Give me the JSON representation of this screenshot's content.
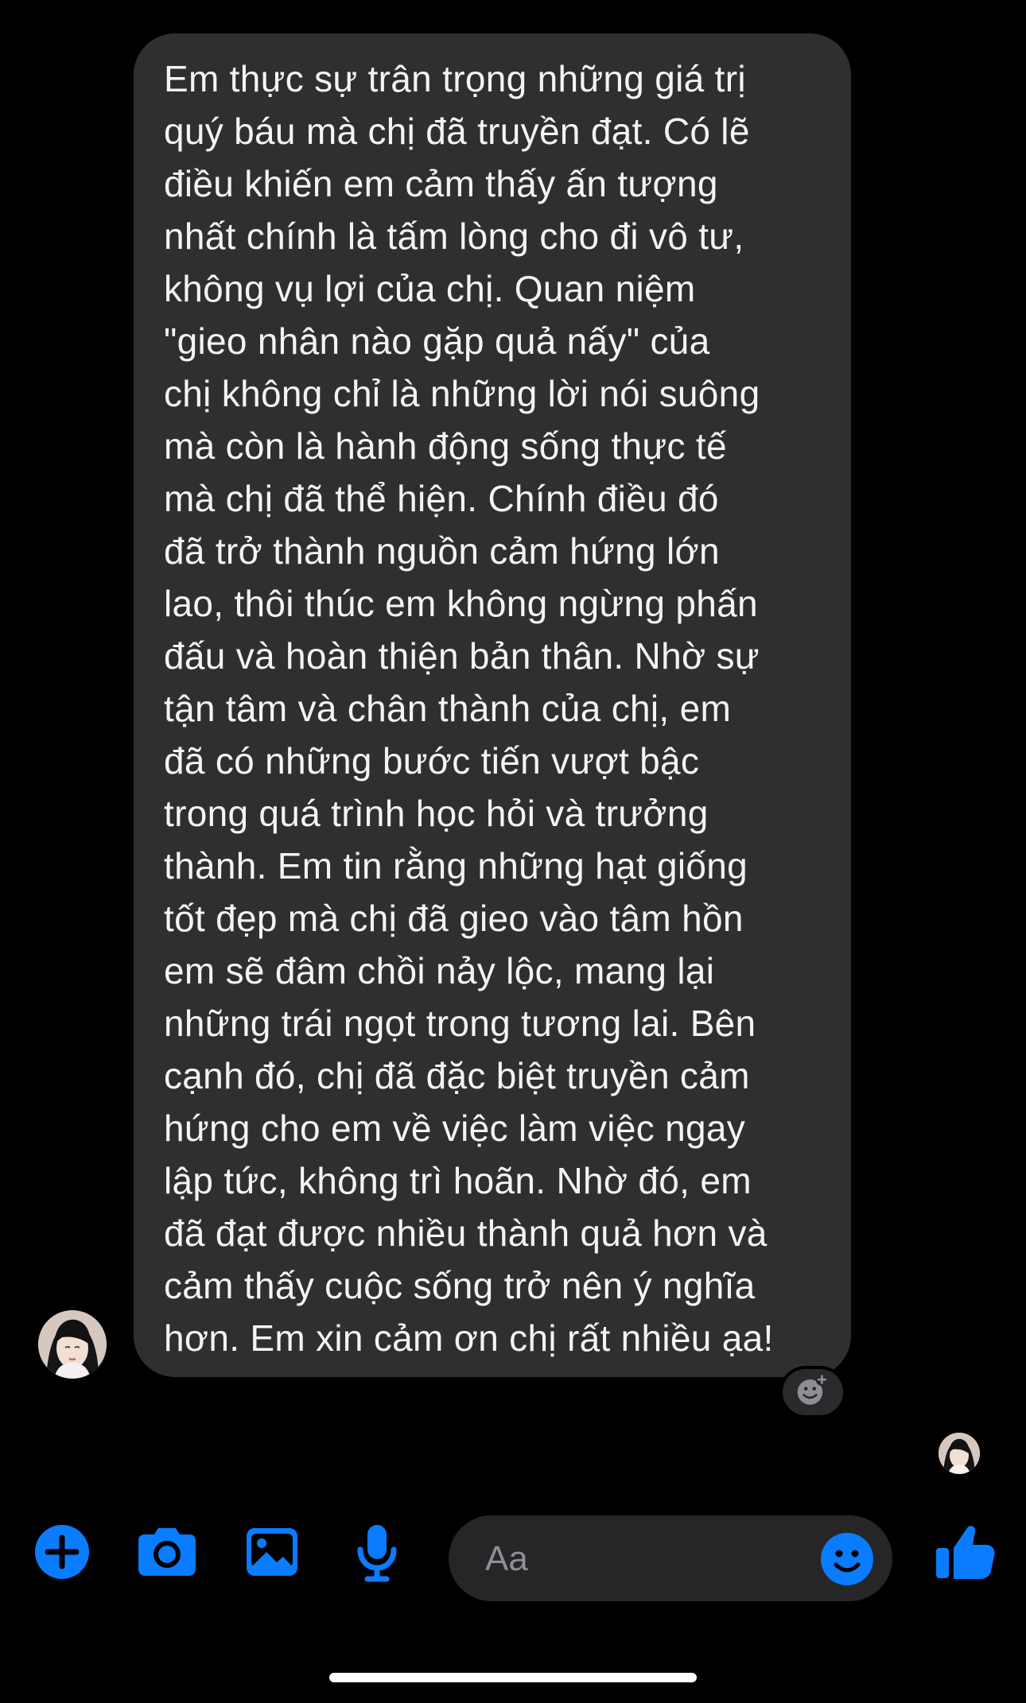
{
  "message": {
    "lines": [
      "Em thực sự trân trọng những giá trị",
      "quý báu mà chị đã truyền đạt. Có lẽ",
      "điều khiến em cảm thấy ấn tượng",
      "nhất chính là tấm lòng cho đi vô tư,",
      "không vụ lợi của chị. Quan niệm",
      "\"gieo nhân nào gặp quả nấy\" của",
      "chị không chỉ là những lời nói suông",
      "mà còn là hành động sống thực tế",
      "mà chị đã thể hiện. Chính điều đó",
      "đã trở thành nguồn cảm hứng lớn",
      "lao, thôi thúc em không ngừng phấn",
      "đấu và hoàn thiện bản thân. Nhờ sự",
      "tận tâm và chân thành của chị, em",
      "đã có những bước tiến vượt bậc",
      "trong quá trình học hỏi và trưởng",
      "thành. Em tin rằng những hạt giống",
      "tốt đẹp mà chị đã gieo vào tâm hồn",
      "em sẽ đâm chồi nảy lộc, mang lại",
      "những trái ngọt trong tương lai. Bên",
      "cạnh đó, chị đã đặc biệt truyền cảm",
      "hứng cho em về việc làm việc ngay",
      "lập tức, không trì hoãn. Nhờ đó, em",
      "đã đạt được nhiều thành quả hơn và",
      "cảm thấy cuộc sống trở nên ý nghĩa",
      "hơn. Em xin cảm ơn chị rất nhiều ạa!"
    ]
  },
  "composer": {
    "placeholder": "Aa"
  },
  "icons": {
    "add": "plus-circle-icon",
    "camera": "camera-icon",
    "gallery": "photo-icon",
    "voice": "microphone-icon",
    "emoji": "smiley-icon",
    "like": "thumbs-up-icon",
    "reaction": "add-reaction-icon"
  },
  "colors": {
    "background": "#000000",
    "bubble": "#2f2f31",
    "accent": "#0a7cff",
    "input": "#262628",
    "placeholder": "#8e8e93"
  }
}
